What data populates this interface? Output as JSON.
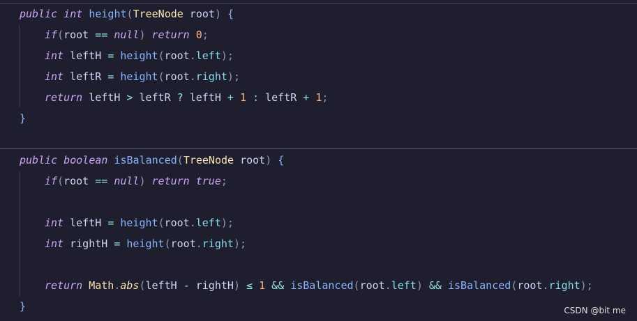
{
  "code": {
    "m1_sig": {
      "kw": "public",
      "type": "int",
      "name": "height",
      "p_open": "(",
      "ptype": "TreeNode",
      "pname": "root",
      "p_close": ")",
      "brace": "{"
    },
    "m1_l1": {
      "kw_if": "if",
      "p_open": "(",
      "var": "root",
      "op": "==",
      "null": "null",
      "p_close": ")",
      "ret": "return",
      "num": "0",
      "semi": ";"
    },
    "m1_l2": {
      "type": "int",
      "var": "leftH",
      "eq": "=",
      "fn": "height",
      "p_open": "(",
      "obj": "root",
      "dot": ".",
      "field": "left",
      "p_close": ")",
      "semi": ";"
    },
    "m1_l3": {
      "type": "int",
      "var": "leftR",
      "eq": "=",
      "fn": "height",
      "p_open": "(",
      "obj": "root",
      "dot": ".",
      "field": "right",
      "p_close": ")",
      "semi": ";"
    },
    "m1_l4": {
      "ret": "return",
      "a": "leftH",
      "gt": ">",
      "b": "leftR",
      "q": "?",
      "c": "leftH",
      "plus1": "+",
      "n1": "1",
      "colon": ":",
      "d": "leftR",
      "plus2": "+",
      "n2": "1",
      "semi": ";"
    },
    "m1_close": "}",
    "m2_sig": {
      "kw": "public",
      "type": "boolean",
      "name": "isBalanced",
      "p_open": "(",
      "ptype": "TreeNode",
      "pname": "root",
      "p_close": ")",
      "brace": "{"
    },
    "m2_l1": {
      "kw_if": "if",
      "p_open": "(",
      "var": "root",
      "op": "==",
      "null": "null",
      "p_close": ")",
      "ret": "return",
      "val": "true",
      "semi": ";"
    },
    "m2_l2": {
      "type": "int",
      "var": "leftH",
      "eq": "=",
      "fn": "height",
      "p_open": "(",
      "obj": "root",
      "dot": ".",
      "field": "left",
      "p_close": ")",
      "semi": ";"
    },
    "m2_l3": {
      "type": "int",
      "var": "rightH",
      "eq": "=",
      "fn": "height",
      "p_open": "(",
      "obj": "root",
      "dot": ".",
      "field": "right",
      "p_close": ")",
      "semi": ";"
    },
    "m2_l4": {
      "ret": "return",
      "cls": "Math",
      "dot1": ".",
      "fn_abs": "abs",
      "p_open": "(",
      "a": "leftH",
      "minus": "-",
      "b": "rightH",
      "p_close": ")",
      "le": "≤",
      "n": "1",
      "and1": "&&",
      "fn1": "isBalanced",
      "p_open2": "(",
      "obj1": "root",
      "dot2": ".",
      "field1": "left",
      "p_close2": ")",
      "and2": "&&",
      "fn2": "isBalanced",
      "p_open3": "(",
      "obj2": "root",
      "dot3": ".",
      "field2": "right",
      "p_close3": ")",
      "semi": ";"
    },
    "m2_close": "}"
  },
  "watermark": "CSDN @bit me"
}
